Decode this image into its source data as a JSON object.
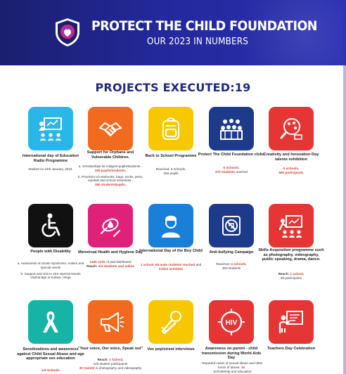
{
  "header": {
    "title": "PROTECT THE CHILD FOUNDATION",
    "subtitle": "OUR 2023 IN NUMBERS"
  },
  "heading": "PROJECTS EXECUTED:19",
  "colors": {
    "header_bg": "#23289a",
    "cyan": "#29b6e8",
    "orange": "#f26a1f",
    "yellow": "#f7c800",
    "navy": "#1e3a8a",
    "red": "#e53535",
    "black": "#111111",
    "magenta": "#e0217a",
    "blue": "#1a7fd6",
    "teal": "#16b3a6",
    "accent_text": "#d43b2f"
  },
  "projects": [
    {
      "icon": "classroom-icon",
      "label": "International day of Education Radio Programme",
      "desc_1": "Marked on 24th January, 2023."
    },
    {
      "icon": "helping-hands-icon",
      "label": "Support for Orphans and Vulnerable Children.",
      "desc_1": "a. Scholarships for indigent pupils/students -",
      "desc_1_hl": "300 pupils/students.",
      "desc_2": "b. Provision of notebooks, bags, socks, pens, sandals and school essentials -",
      "desc_2_hl": "350 students/pupils."
    },
    {
      "icon": "school-bag-icon",
      "label": "Back to School Programme",
      "desc_1": "Reached: 5 Schools,",
      "desc_1b": "250 pupils"
    },
    {
      "icon": "club-group-icon",
      "label": "Protect The Child Foundation clubs",
      "desc_1_hl": "5 Schools,",
      "desc_1b_hl": "470 students",
      "desc_1c": "reached"
    },
    {
      "icon": "creativity-palette-icon",
      "label": "Creativity and Innovation Day talents exhibition",
      "desc_1_hl": "5 schools,",
      "desc_1b_hl": "500 participants"
    },
    {
      "icon": "wheelchair-icon",
      "label": "People with Disability",
      "desc_1": "a. Awareness on Down Syndrome, Autism and special needs",
      "desc_2": "b. Support and visit to JKS Special Needs Orphanage in Kubwa, Abuja"
    },
    {
      "icon": "menstrual-hygiene-icon",
      "label": "Menstrual Health and Hygiene Day",
      "desc_1_hl": "1400 units",
      "desc_1": "of pad distributed",
      "desc_2": "Reach:",
      "desc_2_hl": "3/4 students and online"
    },
    {
      "icon": "boy-child-icon",
      "label": "International Day of the Boy Child",
      "desc_1_hl": "1 school, 60 male students reached",
      "desc_1": "and",
      "desc_1b_hl": "online activities"
    },
    {
      "icon": "anti-bullying-icon",
      "label": "Anti-bullying Campaign",
      "desc_1": "Reached:",
      "desc_1_hl": "4 schools,",
      "desc_1b": "350 students"
    },
    {
      "icon": "skills-presentation-icon",
      "label": "Skills Acquisition programme such as photography, videography, public speaking, drama, dance.",
      "desc_1": "Reach:",
      "desc_1_hl": "1 school,",
      "desc_1b": "60 participants"
    },
    {
      "icon": "awareness-ribbon-icon",
      "label": "Sensitizations and awareness against Child Sexual Abuse and age appropriate sex education",
      "desc_1_hl": "4-5 Schools"
    },
    {
      "icon": "megaphone-icon",
      "label": "\"Your voice, Our voice, Speak out\"",
      "desc_1": "Reach:",
      "desc_1_hl": "1 School,",
      "desc_1b": "120 student participants",
      "desc_2_hl": "30 trained",
      "desc_2": "in photography and videography"
    },
    {
      "icon": "microphone-icon",
      "label": "Vox pop/street interviews"
    },
    {
      "icon": "hiv-awareness-icon",
      "label": "Awareness on parent - child transmission during World Aids Day",
      "desc_1": "- Reported cases of sexual abuse and other forms of abuse:",
      "desc_1_hl": "10",
      "desc_2": "- Scholarship and education"
    },
    {
      "icon": "teacher-board-icon",
      "label": "Teachers Day Celebration"
    }
  ]
}
